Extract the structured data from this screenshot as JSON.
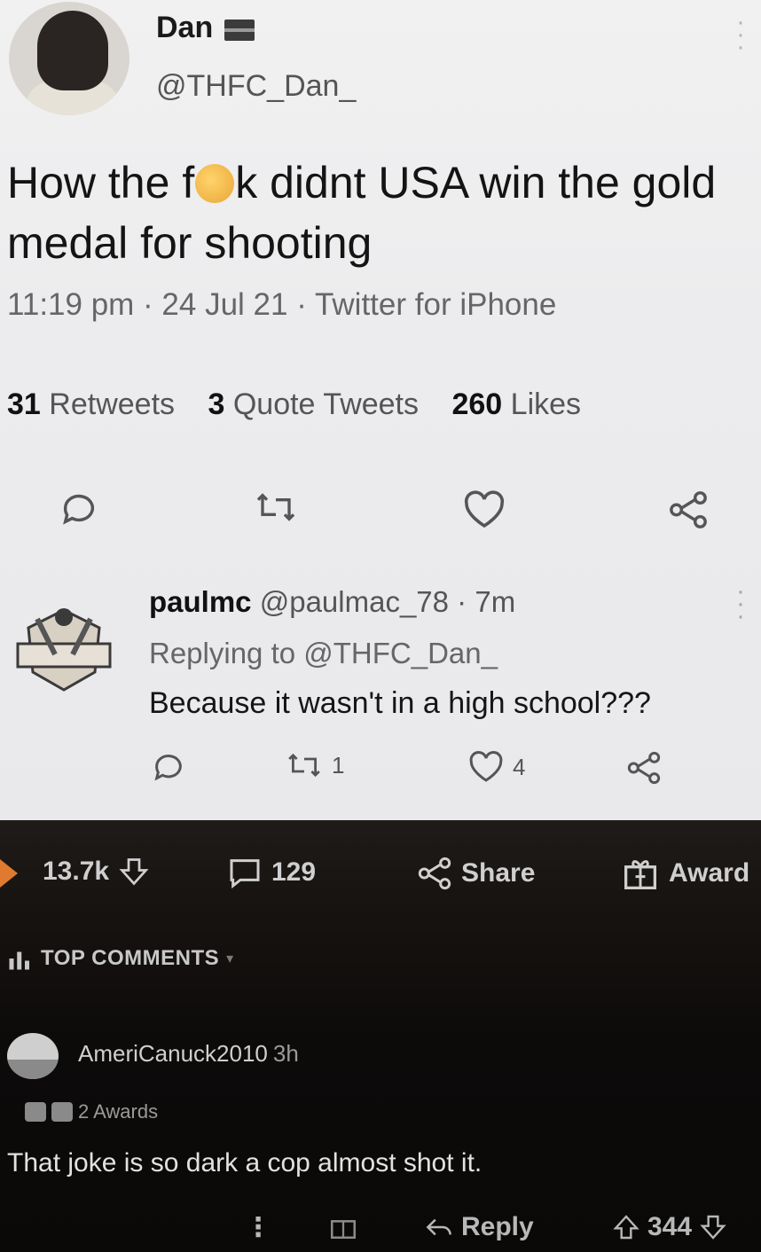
{
  "tweet": {
    "author_name": "Dan",
    "handle": "@THFC_Dan_",
    "text_before": "How the f",
    "text_after": "k didnt USA win the gold medal for shooting",
    "meta": "11:19 pm · 24 Jul 21 · Twitter for iPhone",
    "stats": {
      "retweets_count": "31",
      "retweets_label": "Retweets",
      "quotes_count": "3",
      "quotes_label": "Quote Tweets",
      "likes_count": "260",
      "likes_label": "Likes"
    },
    "icons": [
      "reply-icon",
      "retweet-icon",
      "like-icon",
      "share-icon"
    ]
  },
  "reply": {
    "name": "paulmc",
    "handle_time": "@paulmac_78 · 7m",
    "replying_to": "Replying to @THFC_Dan_",
    "text": "Because it wasn't in a high school???",
    "retweets": "1",
    "likes": "4"
  },
  "reddit": {
    "votes": "13.7k",
    "comments": "129",
    "share_label": "Share",
    "award_label": "Award",
    "sort_label": "TOP COMMENTS",
    "comment": {
      "username": "AmeriCanuck2010",
      "age": "3h",
      "awards": "2 Awards",
      "body": "That joke is so dark a cop almost shot it.",
      "reply_label": "Reply",
      "votes": "344"
    }
  },
  "colors": {
    "tweet_bg": "#ececee",
    "reddit_bg": "#0e0c0b",
    "upvote_accent": "#e07a2e"
  }
}
